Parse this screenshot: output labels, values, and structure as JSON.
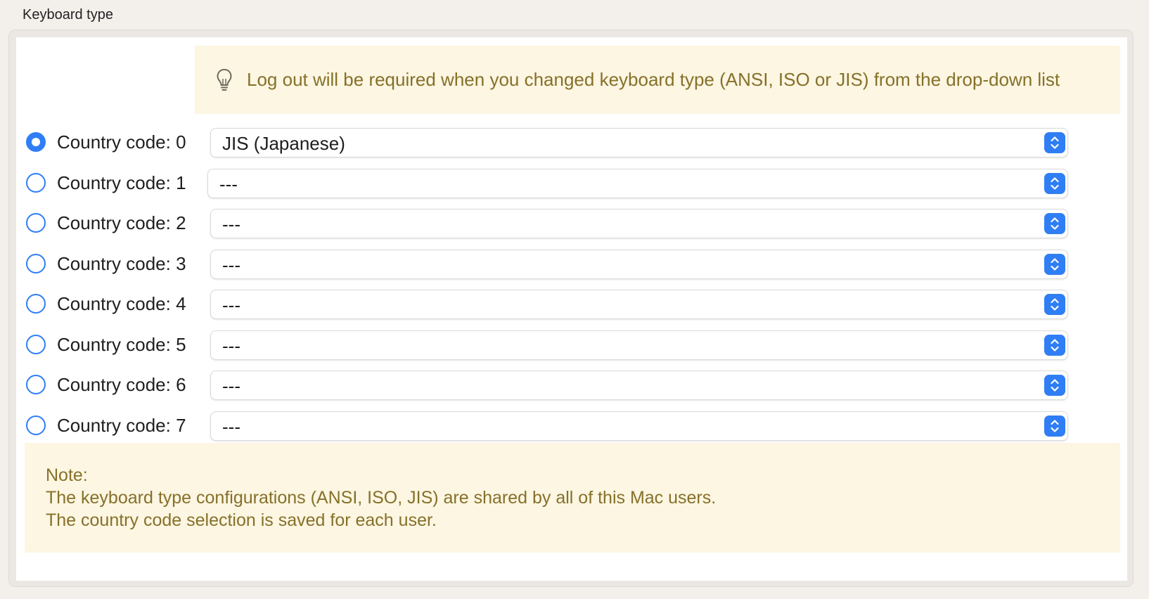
{
  "section": {
    "title": "Keyboard type"
  },
  "tip": {
    "icon": "lightbulb-icon",
    "text": "Log out will be required when you changed keyboard type (ANSI, ISO or JIS) from the drop-down list"
  },
  "rows": [
    {
      "label": "Country code: 0",
      "value": "JIS (Japanese)",
      "selected": true
    },
    {
      "label": "Country code: 1",
      "value": "---",
      "selected": false
    },
    {
      "label": "Country code: 2",
      "value": "---",
      "selected": false
    },
    {
      "label": "Country code: 3",
      "value": "---",
      "selected": false
    },
    {
      "label": "Country code: 4",
      "value": "---",
      "selected": false
    },
    {
      "label": "Country code: 5",
      "value": "---",
      "selected": false
    },
    {
      "label": "Country code: 6",
      "value": "---",
      "selected": false
    },
    {
      "label": "Country code: 7",
      "value": "---",
      "selected": false
    }
  ],
  "note": {
    "heading": "Note:",
    "line1": "The keyboard type configurations (ANSI, ISO, JIS) are shared by all of this Mac users.",
    "line2": "The country code selection is saved for each user."
  },
  "colors": {
    "accent": "#2f7ef5",
    "note_background": "#fcf6e2",
    "note_text": "#86702a"
  }
}
